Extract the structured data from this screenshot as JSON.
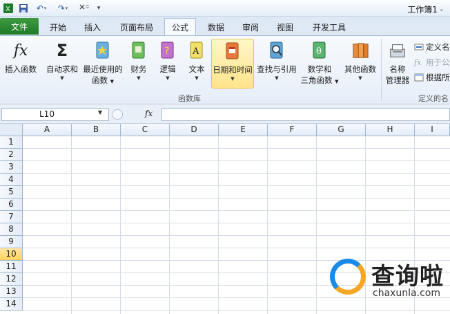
{
  "title": "工作簿1 -",
  "qat": {
    "excel_icon": "excel-app-icon",
    "save_icon": "save-icon",
    "undo_icon": "undo-icon",
    "redo_icon": "redo-icon",
    "customize_icon": "customize-qat-icon"
  },
  "tabs": {
    "file": "文件",
    "items": [
      "开始",
      "插入",
      "页面布局",
      "公式",
      "数据",
      "审阅",
      "视图",
      "开发工具"
    ],
    "active": "公式"
  },
  "ribbon": {
    "buttons": [
      {
        "label": "插入函数",
        "label2": "",
        "icon": "insert-function-icon"
      },
      {
        "label": "自动求和",
        "label2": "",
        "icon": "autosum-icon"
      },
      {
        "label": "最近使用的",
        "label2": "函数",
        "icon": "recent-functions-icon"
      },
      {
        "label": "财务",
        "label2": "",
        "icon": "financial-icon"
      },
      {
        "label": "逻辑",
        "label2": "",
        "icon": "logical-icon"
      },
      {
        "label": "文本",
        "label2": "",
        "icon": "text-icon"
      },
      {
        "label": "日期和时间",
        "label2": "",
        "icon": "date-time-icon"
      },
      {
        "label": "查找与引用",
        "label2": "",
        "icon": "lookup-reference-icon"
      },
      {
        "label": "数学和",
        "label2": "三角函数",
        "icon": "math-trig-icon"
      },
      {
        "label": "其他函数",
        "label2": "",
        "icon": "more-functions-icon"
      },
      {
        "label": "名称",
        "label2": "管理器",
        "icon": "name-manager-icon"
      }
    ],
    "group_function_library": "函数库",
    "group_defined_names": "定义的名",
    "define_name": "定义名",
    "use_in_formula": "用于公",
    "create_from_selection": "根据所"
  },
  "formula_bar": {
    "name_box": "L10",
    "fx_label": "fx",
    "formula": ""
  },
  "grid": {
    "columns": [
      "A",
      "B",
      "C",
      "D",
      "E",
      "F",
      "G",
      "H",
      "I"
    ],
    "rows": [
      "1",
      "2",
      "3",
      "4",
      "5",
      "6",
      "7",
      "8",
      "9",
      "10",
      "11",
      "12",
      "13",
      "14"
    ],
    "selected_row": "10"
  },
  "watermark": {
    "text": "查询啦",
    "url": "chaxunla.com"
  },
  "colors": {
    "file_tab": "#1e7b27",
    "active_button": "#ffe48c",
    "selected_header": "#ffd35d",
    "header_border": "#9eb6ce"
  }
}
